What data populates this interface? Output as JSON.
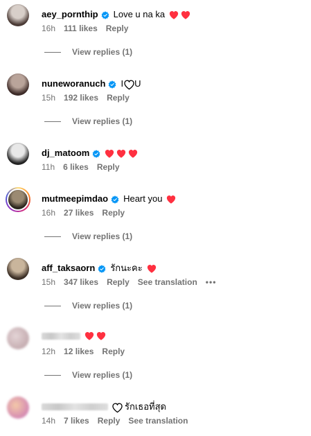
{
  "comments": [
    {
      "username": "aey_pornthip",
      "verified": true,
      "text": "Love u na ka",
      "hearts": 2,
      "time": "16h",
      "likes": "111 likes",
      "reply": "Reply",
      "view_replies": "View replies (1)",
      "avatar_colors": [
        "#d8cfc9",
        "#4a3a35"
      ]
    },
    {
      "username": "nuneworanuch",
      "verified": true,
      "text": "I",
      "text_after": "U",
      "time": "15h",
      "likes": "192 likes",
      "reply": "Reply",
      "view_replies": "View replies (1)",
      "avatar_colors": [
        "#b9a49a",
        "#3d2b28"
      ]
    },
    {
      "username": "dj_matoom",
      "verified": true,
      "hearts": 3,
      "time": "11h",
      "likes": "6 likes",
      "reply": "Reply",
      "avatar_colors": [
        "#e8e8e8",
        "#222222"
      ]
    },
    {
      "username": "mutmeepimdao",
      "verified": true,
      "text": "Heart you",
      "hearts": 1,
      "time": "16h",
      "likes": "27 likes",
      "reply": "Reply",
      "view_replies": "View replies (1)",
      "story_ring": true,
      "avatar_colors": [
        "#9b8a72",
        "#2a241c"
      ]
    },
    {
      "username": "aff_taksaorn",
      "verified": true,
      "text": "รักนะคะ",
      "hearts": 1,
      "time": "15h",
      "likes": "347 likes",
      "reply": "Reply",
      "see_translation": "See translation",
      "more": "•••",
      "view_replies": "View replies (1)",
      "avatar_colors": [
        "#c9b59c",
        "#3b2e25"
      ]
    },
    {
      "blurred": true,
      "hearts": 2,
      "time": "12h",
      "likes": "12 likes",
      "reply": "Reply",
      "view_replies": "View replies (1)",
      "avatar_colors": [
        "#e4d4d6",
        "#b89ca1"
      ]
    },
    {
      "blurred": true,
      "text": "รักเธอที่สุด",
      "outline_heart": true,
      "time": "14h",
      "likes": "7 likes",
      "reply": "Reply",
      "see_translation": "See translation",
      "avatar_colors": [
        "#f4c9a8",
        "#c76fb7"
      ]
    }
  ],
  "colors": {
    "heart": "#ff3040",
    "verified": "#0095f6",
    "meta": "#737373"
  }
}
